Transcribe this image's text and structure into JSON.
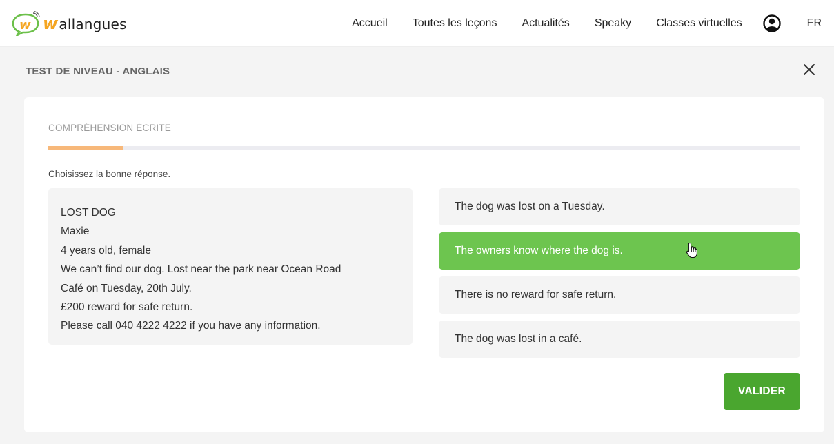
{
  "header": {
    "logo": {
      "letter": "w",
      "text": "allangues"
    },
    "nav": [
      "Accueil",
      "Toutes les leçons",
      "Actualités",
      "Speaky",
      "Classes virtuelles"
    ],
    "language": "FR",
    "icons": {
      "user": "user-circle-icon"
    }
  },
  "test": {
    "title": "TEST DE NIVEAU - ANGLAIS",
    "close_icon": "close-icon"
  },
  "card": {
    "section_label": "COMPRÉHENSION ÉCRITE",
    "progress": 0.1,
    "instruction": "Choisissez la bonne réponse.",
    "passage": [
      "LOST DOG",
      "Maxie",
      "4 years old, female",
      "We can’t find our dog. Lost near the park near Ocean Road",
      "Café on Tuesday, 20th July.",
      "£200 reward for safe return.",
      "Please call 040 4222 4222 if you have any information."
    ],
    "options": [
      "The dog was lost on a Tuesday.",
      "The owners know where the dog is.",
      "There is no reward for safe return.",
      "The dog was lost in a café."
    ],
    "selected_option_index": 1,
    "validate_label": "VALIDER"
  },
  "colors": {
    "accent_orange": "#f7b87a",
    "selected_green": "#6dc54f",
    "button_green": "#4aa62f",
    "logo_green": "#6cc04a",
    "logo_orange": "#f5a623"
  }
}
